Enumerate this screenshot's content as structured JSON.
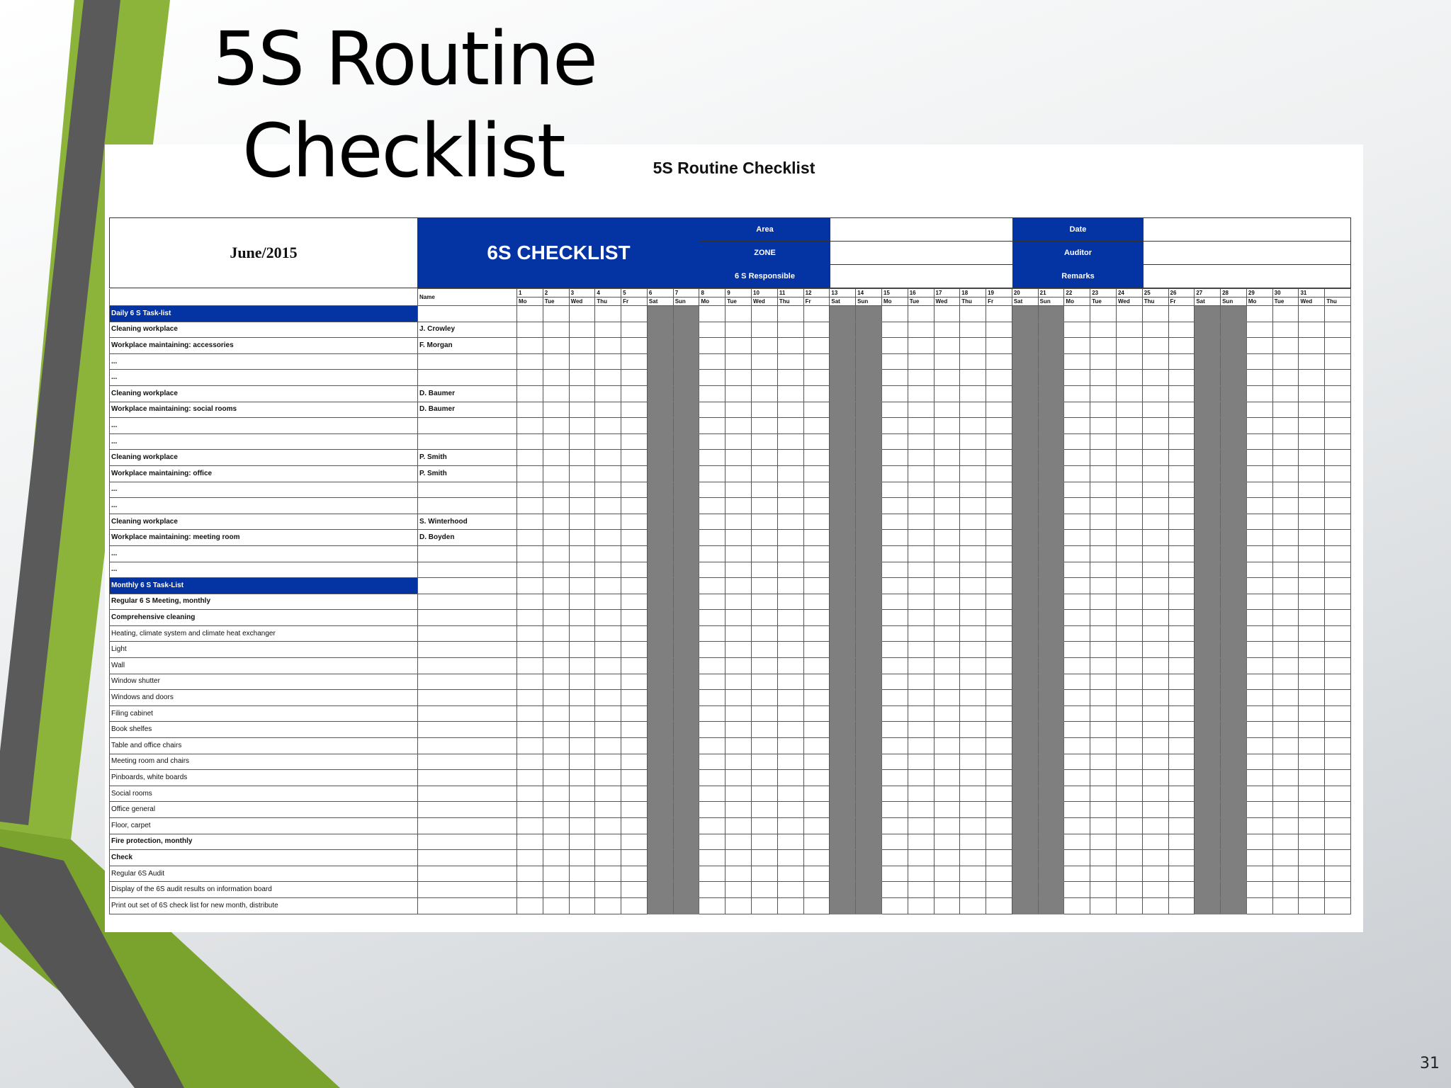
{
  "slide": {
    "title_line1": "5S Routine",
    "title_line2": "Checklist",
    "page_number": "31"
  },
  "document": {
    "heading": "5S Routine Checklist",
    "month": "June/2015",
    "checklist_title": "6S CHECKLIST",
    "header_labels": {
      "area": "Area",
      "zone": "ZONE",
      "responsible": "6 S Responsible",
      "date": "Date",
      "auditor": "Auditor",
      "remarks": "Remarks"
    },
    "name_header": "Name",
    "day_numbers": [
      "1",
      "2",
      "3",
      "4",
      "5",
      "6",
      "7",
      "8",
      "9",
      "10",
      "11",
      "12",
      "13",
      "14",
      "15",
      "16",
      "17",
      "18",
      "19",
      "20",
      "21",
      "22",
      "23",
      "24",
      "25",
      "26",
      "27",
      "28",
      "29",
      "30",
      "31"
    ],
    "day_codes": [
      "Mo",
      "Tue",
      "Wed",
      "Thu",
      "Fr",
      "Sat",
      "Sun",
      "Mo",
      "Tue",
      "Wed",
      "Thu",
      "Fr",
      "Sat",
      "Sun",
      "Mo",
      "Tue",
      "Wed",
      "Thu",
      "Fr",
      "Sat",
      "Sun",
      "Mo",
      "Tue",
      "Wed",
      "Thu",
      "Fr",
      "Sat",
      "Sun",
      "Mo",
      "Tue",
      "Wed",
      "Thu"
    ],
    "weekend_day_indices": [
      5,
      6,
      12,
      13,
      19,
      20,
      26,
      27
    ],
    "rows": [
      {
        "task": "Daily 6 S Task-list",
        "name": "",
        "type": "section"
      },
      {
        "task": "Cleaning workplace",
        "name": "J. Crowley",
        "type": "bold"
      },
      {
        "task": "Workplace maintaining: accessories",
        "name": "F. Morgan",
        "type": "bold"
      },
      {
        "task": "...",
        "name": "",
        "type": "bold"
      },
      {
        "task": "...",
        "name": "",
        "type": "bold"
      },
      {
        "task": "Cleaning workplace",
        "name": "D. Baumer",
        "type": "bold"
      },
      {
        "task": "Workplace maintaining: social rooms",
        "name": "D. Baumer",
        "type": "bold"
      },
      {
        "task": "...",
        "name": "",
        "type": "bold"
      },
      {
        "task": "...",
        "name": "",
        "type": "bold"
      },
      {
        "task": "Cleaning workplace",
        "name": "P. Smith",
        "type": "bold"
      },
      {
        "task": "Workplace maintaining: office",
        "name": "P. Smith",
        "type": "bold"
      },
      {
        "task": "...",
        "name": "",
        "type": "bold"
      },
      {
        "task": "...",
        "name": "",
        "type": "bold"
      },
      {
        "task": "Cleaning workplace",
        "name": "S. Winterhood",
        "type": "bold"
      },
      {
        "task": "Workplace maintaining: meeting room",
        "name": "D. Boyden",
        "type": "bold"
      },
      {
        "task": "...",
        "name": "",
        "type": "bold"
      },
      {
        "task": "...",
        "name": "",
        "type": "bold"
      },
      {
        "task": "Monthly 6 S Task-List",
        "name": "",
        "type": "section"
      },
      {
        "task": "Regular 6 S Meeting, monthly",
        "name": "",
        "type": "bold"
      },
      {
        "task": "Comprehensive cleaning",
        "name": "",
        "type": "bold"
      },
      {
        "task": "Heating, climate system and climate heat exchanger",
        "name": "",
        "type": "plain"
      },
      {
        "task": "Light",
        "name": "",
        "type": "plain"
      },
      {
        "task": "Wall",
        "name": "",
        "type": "plain"
      },
      {
        "task": "Window shutter",
        "name": "",
        "type": "plain"
      },
      {
        "task": "Windows and doors",
        "name": "",
        "type": "plain"
      },
      {
        "task": "Filing cabinet",
        "name": "",
        "type": "plain"
      },
      {
        "task": "Book shelfes",
        "name": "",
        "type": "plain"
      },
      {
        "task": "Table and office chairs",
        "name": "",
        "type": "plain"
      },
      {
        "task": "Meeting room and chairs",
        "name": "",
        "type": "plain"
      },
      {
        "task": "Pinboards, white boards",
        "name": "",
        "type": "plain"
      },
      {
        "task": "Social rooms",
        "name": "",
        "type": "plain"
      },
      {
        "task": "Office general",
        "name": "",
        "type": "plain"
      },
      {
        "task": "Floor, carpet",
        "name": "",
        "type": "plain"
      },
      {
        "task": "Fire protection, monthly",
        "name": "",
        "type": "bold"
      },
      {
        "task": "Check",
        "name": "",
        "type": "bold"
      },
      {
        "task": "Regular 6S Audit",
        "name": "",
        "type": "plain"
      },
      {
        "task": "Display of the 6S audit results on information board",
        "name": "",
        "type": "plain"
      },
      {
        "task": "Print out set of 6S check list for new month, distribute",
        "name": "",
        "type": "plain"
      }
    ]
  },
  "colors": {
    "header_blue": "#0433a4",
    "weekend_gray": "#7f7f7f",
    "accent_green": "#8cb43a",
    "band_dark": "#555555"
  }
}
